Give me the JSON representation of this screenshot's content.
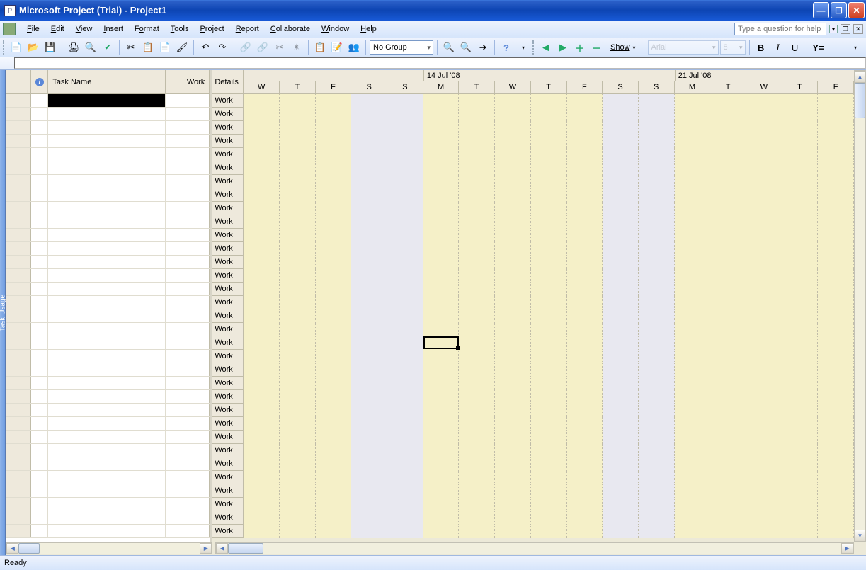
{
  "window": {
    "title": "Microsoft Project (Trial) - Project1"
  },
  "menu": {
    "items": [
      "File",
      "Edit",
      "View",
      "Insert",
      "Format",
      "Tools",
      "Project",
      "Report",
      "Collaborate",
      "Window",
      "Help"
    ],
    "help_placeholder": "Type a question for help"
  },
  "toolbar": {
    "group_combo": "No Group",
    "show_label": "Show",
    "font_combo": "Arial",
    "size_combo": "8"
  },
  "sidebar": {
    "label": "Task Usage"
  },
  "left": {
    "columns": {
      "task_name": "Task Name",
      "work": "Work"
    }
  },
  "right": {
    "details_label": "Details",
    "row_label": "Work",
    "dates": [
      {
        "label": "14 Jul '08",
        "col_index": 5
      },
      {
        "label": "21 Jul '08",
        "col_index": 12
      }
    ],
    "days": [
      "W",
      "T",
      "F",
      "S",
      "S",
      "M",
      "T",
      "W",
      "T",
      "F",
      "S",
      "S",
      "M",
      "T",
      "W",
      "T",
      "F"
    ],
    "day_types": [
      "wd",
      "wd",
      "wd",
      "we",
      "we",
      "wd",
      "wd",
      "wd",
      "wd",
      "wd",
      "we",
      "we",
      "wd",
      "wd",
      "wd",
      "wd",
      "wd"
    ],
    "num_rows": 33,
    "selected": {
      "row": 18,
      "col": 5
    }
  },
  "status": {
    "text": "Ready"
  }
}
